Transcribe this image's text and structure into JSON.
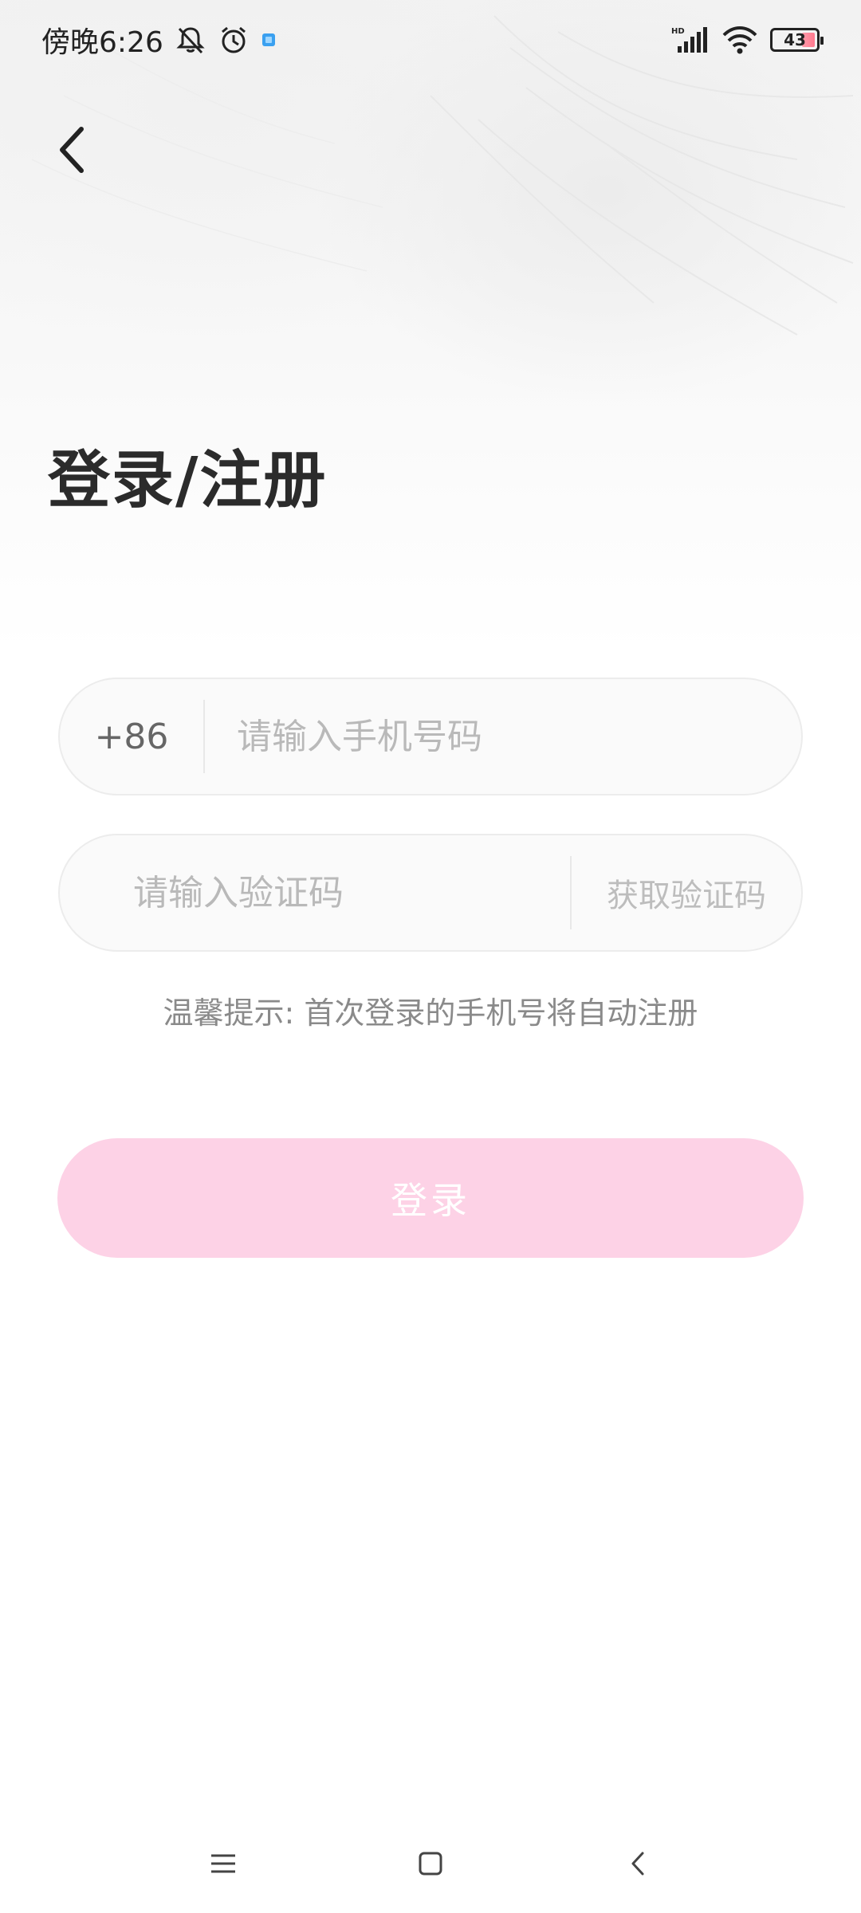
{
  "status_bar": {
    "time": "傍晚6:26",
    "icons": [
      "mute-bell-icon",
      "alarm-icon",
      "app-notification-icon",
      "hd-signal-icon",
      "wifi-icon",
      "battery-icon"
    ],
    "battery_level": "43"
  },
  "header": {
    "back_icon": "chevron-left-icon"
  },
  "main": {
    "title": "登录/注册",
    "phone": {
      "prefix": "+86",
      "placeholder": "请输入手机号码",
      "value": ""
    },
    "code": {
      "placeholder": "请输入验证码",
      "value": "",
      "get_code_label": "获取验证码"
    },
    "hint": "温馨提示: 首次登录的手机号将自动注册",
    "login_label": "登录"
  },
  "colors": {
    "login_button_bg": "#fdd2e6",
    "title_text": "#2b2b2b",
    "placeholder_text": "#b9b9b9"
  },
  "nav_bar": {
    "icons": [
      "menu-icon",
      "home-icon",
      "back-icon"
    ]
  }
}
